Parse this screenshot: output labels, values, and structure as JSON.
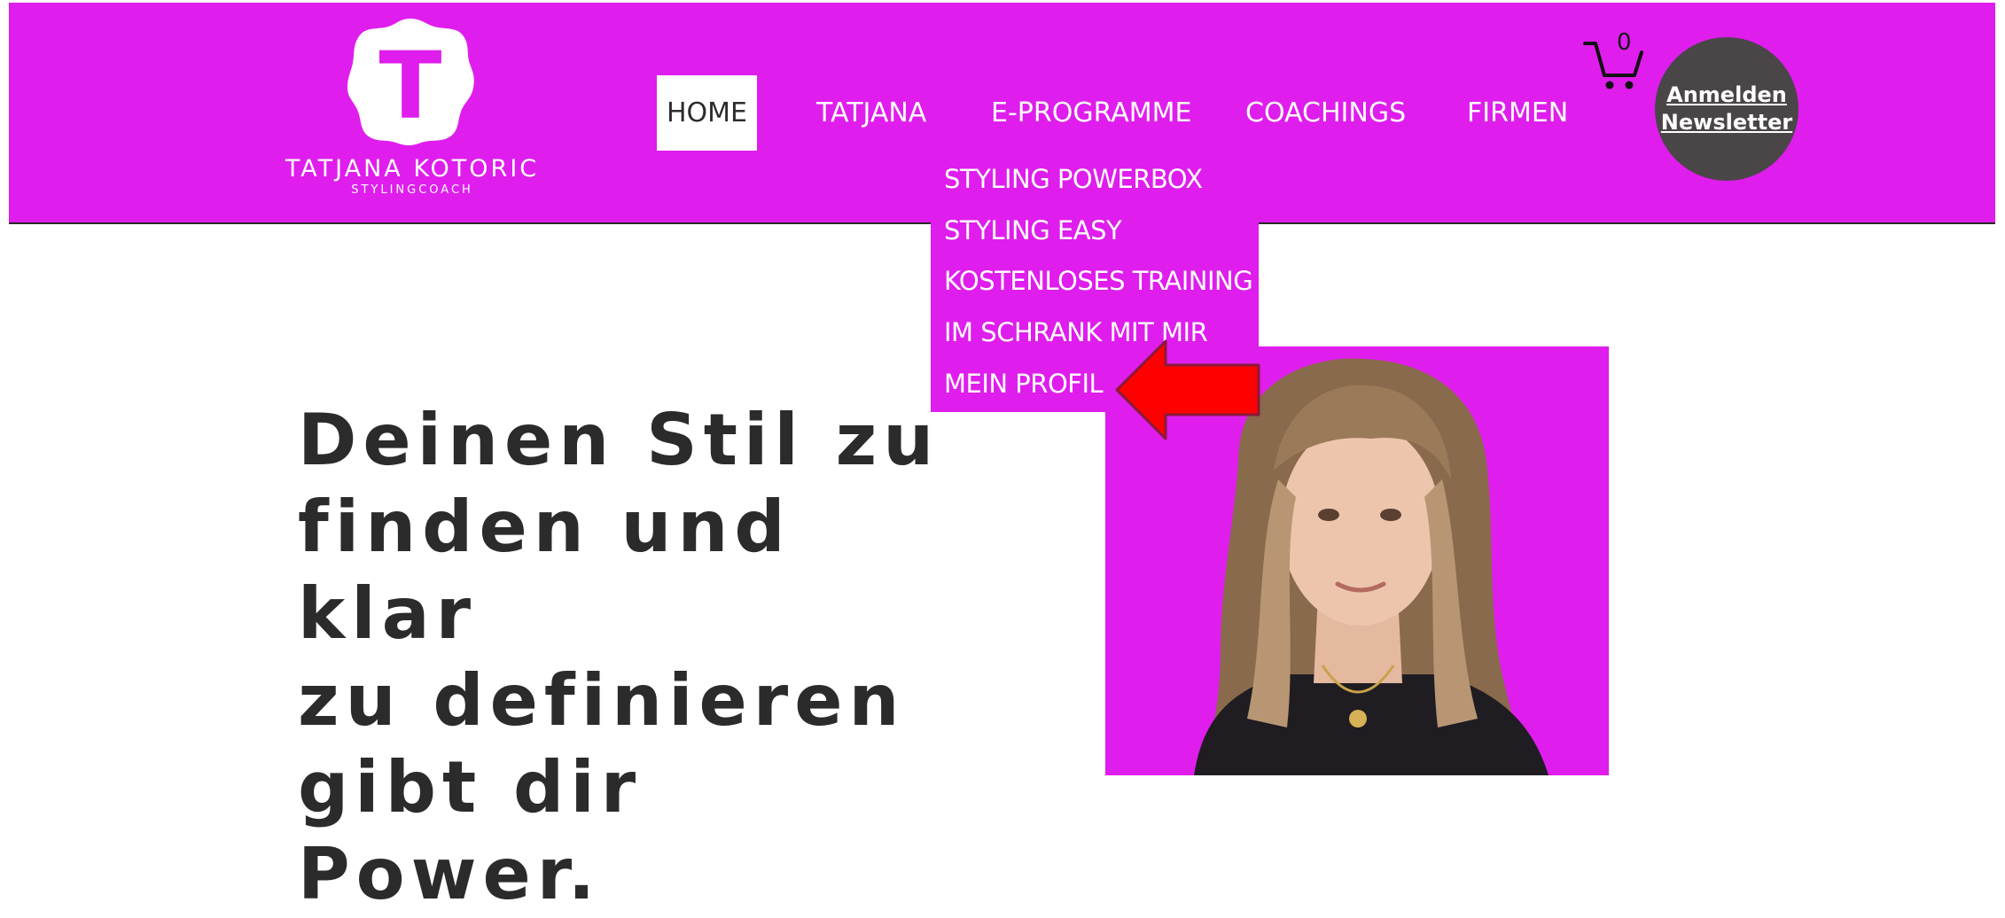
{
  "brand": {
    "logo_letter": "T",
    "name": "TATJANA KOTORIC",
    "subtitle": "STYLINGCOACH",
    "accent_color": "#df1ded"
  },
  "nav": {
    "items": [
      {
        "label": "HOME",
        "active": true
      },
      {
        "label": "TATJANA",
        "active": false
      },
      {
        "label": "E-PROGRAMME",
        "active": false
      },
      {
        "label": "COACHINGS",
        "active": false
      },
      {
        "label": "FIRMEN",
        "active": false
      }
    ]
  },
  "cart": {
    "icon": "cart-icon",
    "count": "0"
  },
  "newsletter": {
    "line1": "Anmelden",
    "line2": "Newsletter"
  },
  "dropdown": {
    "items": [
      "STYLING POWERBOX",
      "STYLING EASY",
      "KOSTENLOSES TRAINING",
      "IM SCHRANK MIT MIR",
      "MEIN PROFIL"
    ]
  },
  "annotation": {
    "icon": "red-arrow-icon",
    "color": "#ff0000"
  },
  "hero": {
    "headline_lines": [
      "Deinen Stil zu",
      "finden und klar",
      "zu definieren",
      "gibt dir Power."
    ]
  }
}
